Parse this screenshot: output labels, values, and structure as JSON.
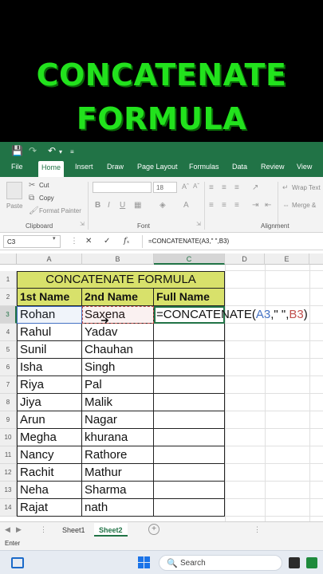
{
  "banner": {
    "line1": "CONCATENATE",
    "line2": "FORMULA"
  },
  "titlebar": {
    "save_icon": "save-icon",
    "undo_icon": "undo-icon",
    "redo_icon": "redo-icon"
  },
  "ribbon_tabs": [
    "File",
    "Home",
    "Insert",
    "Draw",
    "Page Layout",
    "Formulas",
    "Data",
    "Review",
    "View"
  ],
  "active_tab": "Home",
  "ribbon": {
    "paste": "Paste",
    "cut": "Cut",
    "copy": "Copy",
    "format_painter": "Format Painter",
    "clipboard": "Clipboard",
    "font_size": "18",
    "font": "Font",
    "wrap_text": "Wrap Text",
    "merge": "Merge &",
    "alignment": "Alignment"
  },
  "formula_bar": {
    "name_box": "C3",
    "formula": "=CONCATENATE(A3,\" \",B3)"
  },
  "columns": [
    "A",
    "B",
    "C",
    "D",
    "E"
  ],
  "rows": [
    "1",
    "2",
    "3",
    "4",
    "5",
    "6",
    "7",
    "8",
    "9",
    "10",
    "11",
    "12",
    "13",
    "14"
  ],
  "sheet": {
    "title": "CONCATENATE FORMULA",
    "headers": [
      "1st Name",
      "2nd Name",
      "Full Name"
    ],
    "data": [
      [
        "Rohan",
        "Saxena"
      ],
      [
        "Rahul",
        "Yadav"
      ],
      [
        "Sunil",
        "Chauhan"
      ],
      [
        "Isha",
        "Singh"
      ],
      [
        "Riya",
        "Pal"
      ],
      [
        "Jiya",
        "Malik"
      ],
      [
        "Arun",
        "Nagar"
      ],
      [
        "Megha",
        "khurana"
      ],
      [
        "Nancy",
        "Rathore"
      ],
      [
        "Rachit",
        "Mathur"
      ],
      [
        "Neha",
        "Sharma"
      ],
      [
        "Rajat",
        "nath"
      ]
    ],
    "c3_formula": {
      "prefix": "=CONCATENATE(",
      "ref_a": "A3",
      "middle": ",\" \",",
      "ref_b": "B3",
      "suffix": ")"
    }
  },
  "sheet_tabs": [
    "Sheet1",
    "Sheet2"
  ],
  "active_sheet": "Sheet2",
  "status": "Enter",
  "taskbar": {
    "search_label": "Search"
  },
  "colors": {
    "excel_green": "#217346",
    "banner_green": "#22e21d",
    "header_fill": "#d8e16b"
  }
}
